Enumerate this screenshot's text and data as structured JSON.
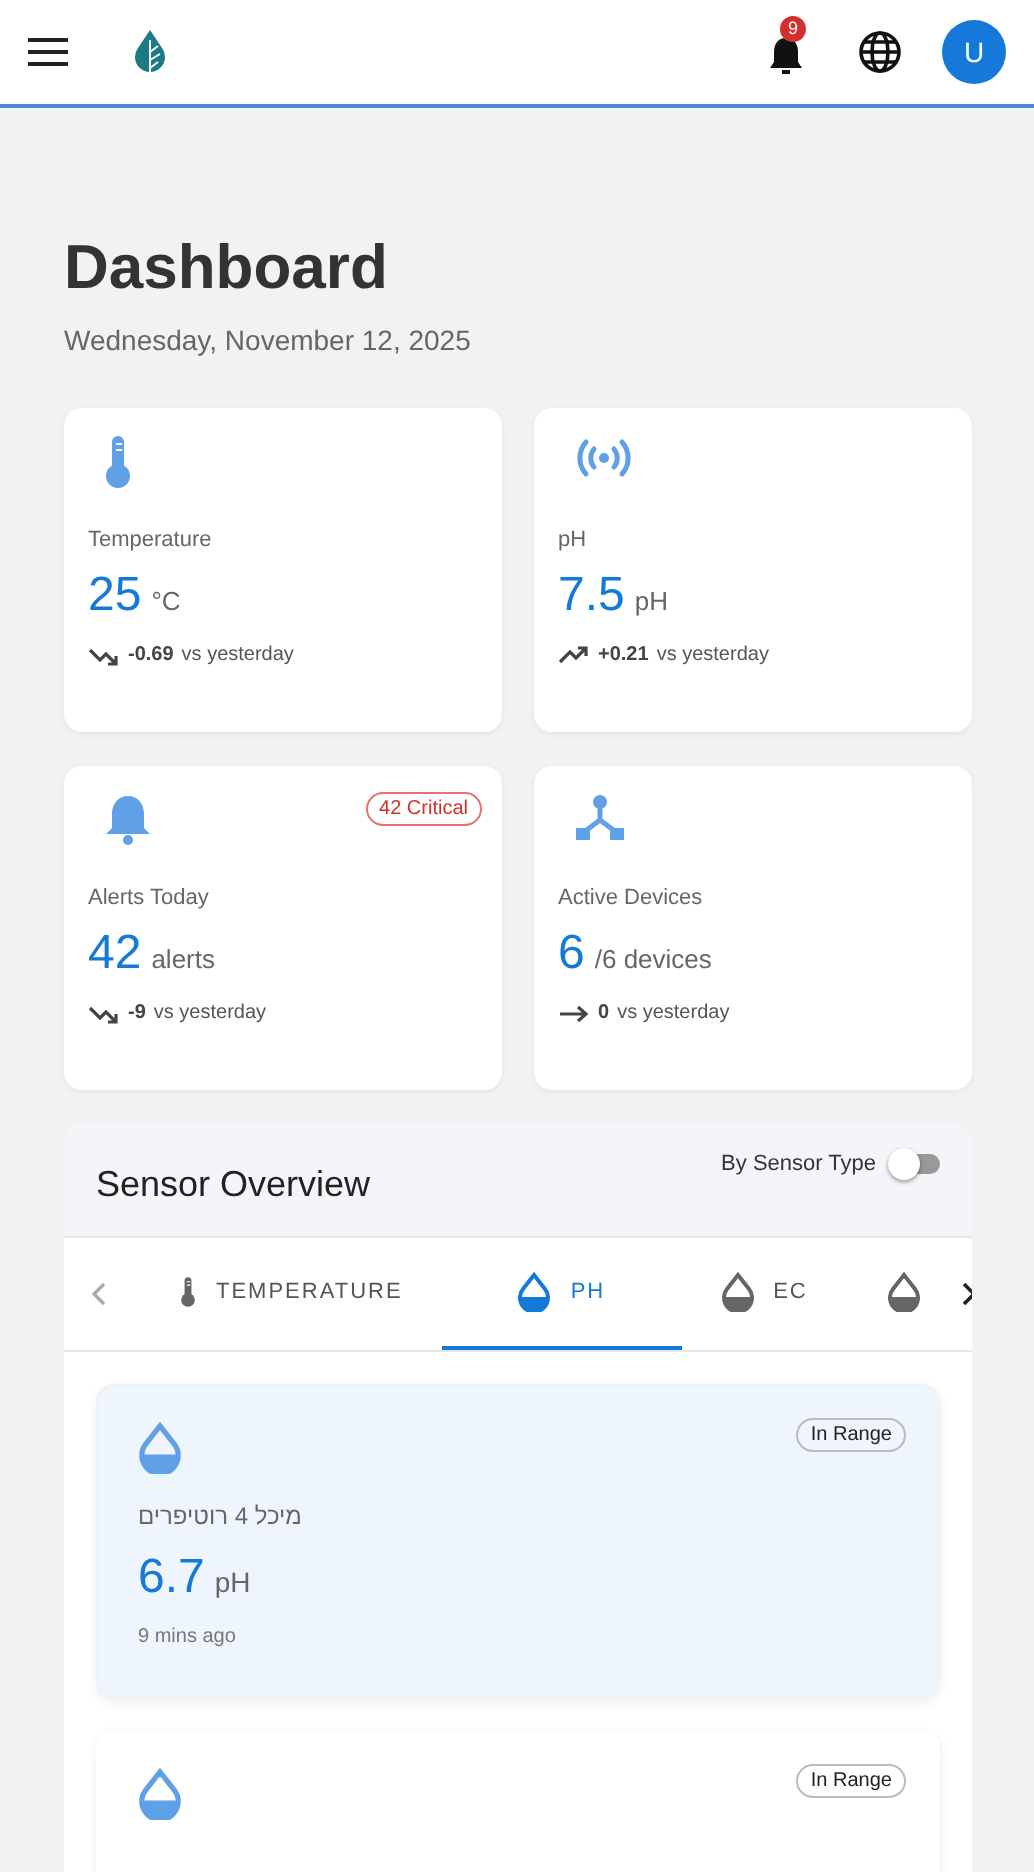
{
  "header": {
    "notification_count": "9",
    "avatar": "U"
  },
  "page": {
    "title": "Dashboard",
    "date": "Wednesday, November 12, 2025"
  },
  "stats": [
    {
      "kind": "down",
      "label": "Temperature",
      "value": "25",
      "unit": "°C",
      "change": "-0.69",
      "compare": "vs yesterday"
    },
    {
      "kind": "up",
      "label": "pH",
      "value": "7.5",
      "unit": "pH",
      "change": "+0.21",
      "compare": "vs yesterday"
    },
    {
      "kind": "down",
      "label": "Alerts Today",
      "value": "42",
      "unit": "alerts",
      "change": "-9",
      "compare": "vs yesterday",
      "badge": "42 Critical"
    },
    {
      "kind": "flat",
      "label": "Active Devices",
      "value": "6",
      "unit": "/6 devices",
      "change": "0",
      "compare": "vs yesterday"
    }
  ],
  "sensor_overview": {
    "title": "Sensor Overview",
    "toggle": {
      "label": "By Sensor Type",
      "on": false
    },
    "tabs": [
      {
        "label": "TEMPERATURE",
        "selected": false
      },
      {
        "label": "PH",
        "selected": true
      },
      {
        "label": "EC",
        "selected": false
      },
      {
        "selected": false
      }
    ],
    "cards": [
      {
        "selected": true,
        "status": "In Range",
        "name": "מיכל 4 רוטיפרים",
        "value": "6.7",
        "unit": "pH",
        "time": "9 mins ago"
      },
      {
        "selected": false,
        "status": "In Range"
      }
    ]
  }
}
